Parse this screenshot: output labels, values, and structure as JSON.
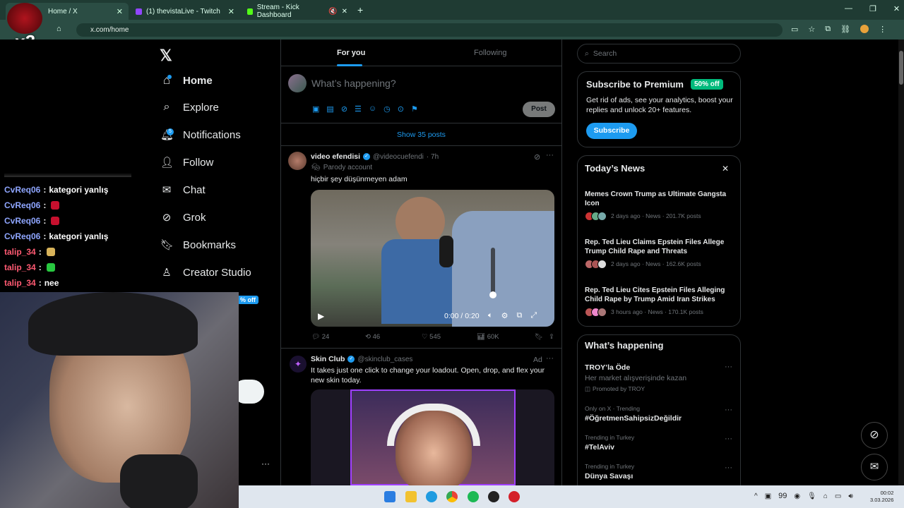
{
  "browser": {
    "tabs": [
      {
        "title": "Home / X",
        "active": true
      },
      {
        "title": "(1) thevistaLive - Twitch"
      },
      {
        "title": "Stream - Kick Dashboard"
      }
    ],
    "url": "x.com/home",
    "overlay_badge": "x2"
  },
  "x": {
    "nav": [
      {
        "label": "Home",
        "icon": "home-icon"
      },
      {
        "label": "Explore",
        "icon": "search-icon"
      },
      {
        "label": "Notifications",
        "icon": "bell-icon"
      },
      {
        "label": "Follow",
        "icon": "follow-icon"
      },
      {
        "label": "Chat",
        "icon": "mail-icon"
      },
      {
        "label": "Grok",
        "icon": "grok-icon"
      },
      {
        "label": "Bookmarks",
        "icon": "bookmark-icon"
      },
      {
        "label": "Creator Studio",
        "icon": "creator-icon"
      }
    ],
    "notif_count": "5",
    "premium_partial": "% off",
    "more_dots": "···",
    "tabs": {
      "for_you": "For you",
      "following": "Following"
    },
    "composer": {
      "placeholder": "What’s happening?",
      "post_button": "Post"
    },
    "show_posts": "Show 35 posts",
    "post1": {
      "name": "video efendisi",
      "handle": "@videocuefendi",
      "time": "· 7h",
      "parody": "Parody account",
      "text": "hiçbir şey düşünmeyen adam",
      "video_time": "0:00 / 0:20",
      "replies": "24",
      "reposts": "46",
      "likes": "545",
      "views": "60K"
    },
    "post2": {
      "name": "Skin Club",
      "handle": "@skinclub_cases",
      "ad": "Ad",
      "text": "It takes just one click to change your loadout. Open, drop, and flex your new skin today."
    },
    "search_placeholder": "Search",
    "premium": {
      "title": "Subscribe to Premium",
      "badge": "50% off",
      "desc": "Get rid of ads, see your analytics, boost your replies and unlock 20+ features.",
      "button": "Subscribe"
    },
    "news": {
      "title": "Today’s News",
      "items": [
        {
          "headline": "Memes Crown Trump as Ultimate Gangsta Icon",
          "meta": "2 days ago · News · 201.7K posts"
        },
        {
          "headline": "Rep. Ted Lieu Claims Epstein Files Allege Trump Child Rape and Threats",
          "meta": "2 days ago · News · 162.6K posts"
        },
        {
          "headline": "Rep. Ted Lieu Cites Epstein Files Alleging Child Rape by Trump Amid Iran Strikes",
          "meta": "3 hours ago · News · 170.1K posts"
        }
      ]
    },
    "happening": {
      "title": "What’s happening",
      "items": [
        {
          "context": "",
          "topic": "TROY’la Öde",
          "sub": "Her market alışverişinde kazan",
          "promo": "Promoted by TROY"
        },
        {
          "context": "Only on X · Trending",
          "topic": "#ÖğretmenSahipsizDeğildir"
        },
        {
          "context": "Trending in Turkey",
          "topic": "#TelAviv"
        },
        {
          "context": "Trending in Turkey",
          "topic": "Dünya Savaşı"
        }
      ]
    }
  },
  "chat": [
    {
      "user": "CvReq06",
      "msg": "kategori yanlış",
      "color": "blue"
    },
    {
      "user": "CvReq06",
      "msg": "",
      "color": "blue",
      "emote": true
    },
    {
      "user": "CvReq06",
      "msg": "",
      "color": "blue",
      "emote": true
    },
    {
      "user": "CvReq06",
      "msg": "kategori yanlış",
      "color": "blue"
    },
    {
      "user": "talip_34",
      "msg": "",
      "color": "red",
      "emote": true
    },
    {
      "user": "talip_34",
      "msg": "",
      "color": "red",
      "emote": true
    },
    {
      "user": "talip_34",
      "msg": "nee",
      "color": "red"
    }
  ],
  "taskbar": {
    "number": "99",
    "clock": "00:02",
    "date": "3.03.2026"
  },
  "colors": {
    "accent": "#1d9bf0",
    "premium_green": "#00ba7c",
    "chrome": "#1f3b33"
  }
}
